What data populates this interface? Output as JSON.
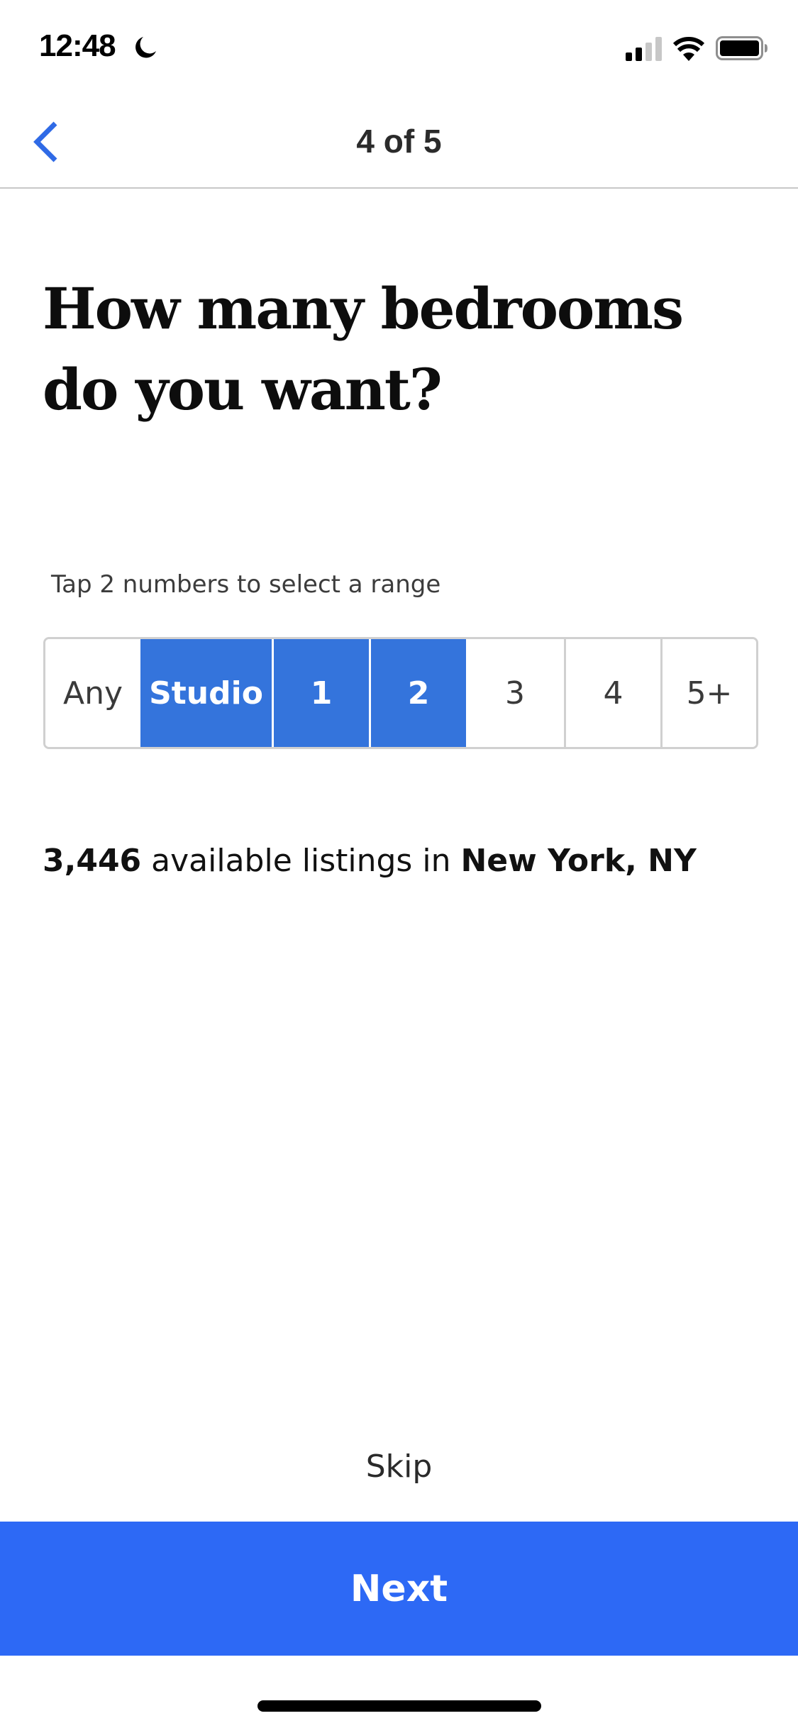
{
  "status_bar": {
    "time": "12:48",
    "icons": [
      "moon-icon",
      "cellular-signal-icon",
      "wifi-icon",
      "battery-icon"
    ]
  },
  "nav": {
    "back_icon": "chevron-left-icon",
    "title": "4 of 5"
  },
  "headline": "How many bedrooms do you want?",
  "hint": "Tap 2 numbers to select a range",
  "bedroom_options": [
    {
      "label": "Any",
      "selected": false
    },
    {
      "label": "Studio",
      "selected": true
    },
    {
      "label": "1",
      "selected": true
    },
    {
      "label": "2",
      "selected": true
    },
    {
      "label": "3",
      "selected": false
    },
    {
      "label": "4",
      "selected": false
    },
    {
      "label": "5+",
      "selected": false
    }
  ],
  "listings": {
    "count": "3,446",
    "middle_text": " available listings in ",
    "location": "New York, NY"
  },
  "skip_label": "Skip",
  "next_label": "Next",
  "colors": {
    "accent": "#2d69f5",
    "selected_segment": "#3474dc",
    "back_chevron": "#2f6ae6"
  }
}
